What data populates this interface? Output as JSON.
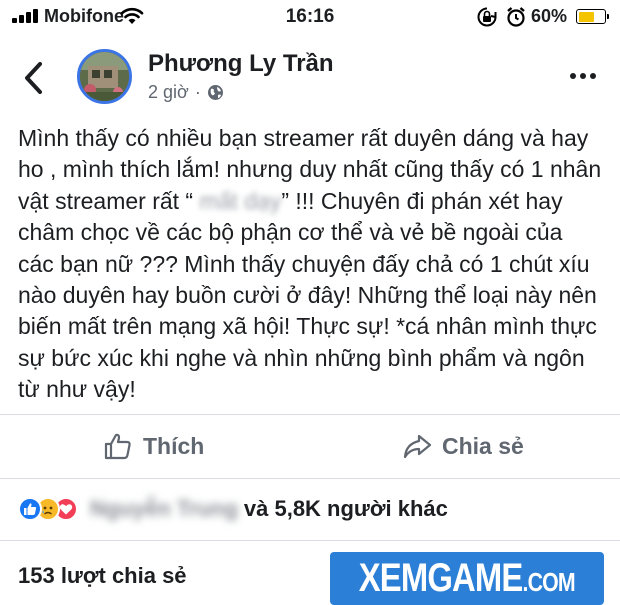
{
  "status_bar": {
    "carrier": "Mobifone",
    "time": "16:16",
    "battery_percent": "60%",
    "battery_level": 0.6
  },
  "post": {
    "author": "Phương Ly Trần",
    "timestamp": "2 giờ",
    "separator": "·",
    "privacy_icon": "globe-icon",
    "text_before": "Mình thấy có nhiều bạn streamer rất duyên dáng và hay ho , mình thích lắm! nhưng duy nhất cũng thấy có 1 nhân vật streamer rất “ ",
    "text_blurred": "mất dạy",
    "text_after": "” !!! Chuyên đi phán xét hay châm chọc về các bộ phận cơ thể và vẻ bề ngoài của các bạn nữ ??? Mình thấy chuyện đấy chả có 1 chút xíu nào duyên hay buồn cười ở đây! Những thể loại này nên biến mất trên mạng xã hội! Thực sự! *cá nhân mình thực sự bức xúc khi nghe và nhìn những bình phẩm và ngôn từ như vậy!"
  },
  "actions": {
    "like_label": "Thích",
    "share_label": "Chia sẻ"
  },
  "reactions": {
    "icons": [
      "like-icon",
      "sad-icon",
      "love-icon"
    ],
    "names_blurred": "Nguyễn Trung",
    "others_text": "và 5,8K người khác"
  },
  "shares": {
    "count_text": "153 lượt chia sẻ"
  },
  "watermark": {
    "main": "XEMGAME",
    "suffix": ".COM"
  },
  "colors": {
    "accent": "#3b74e5",
    "text": "#1c1e21",
    "secondary": "#606770",
    "like_blue": "#1877f2",
    "love_red": "#f33e58",
    "sad_yellow": "#f7b928",
    "watermark_bg": "#2c7fd6"
  }
}
